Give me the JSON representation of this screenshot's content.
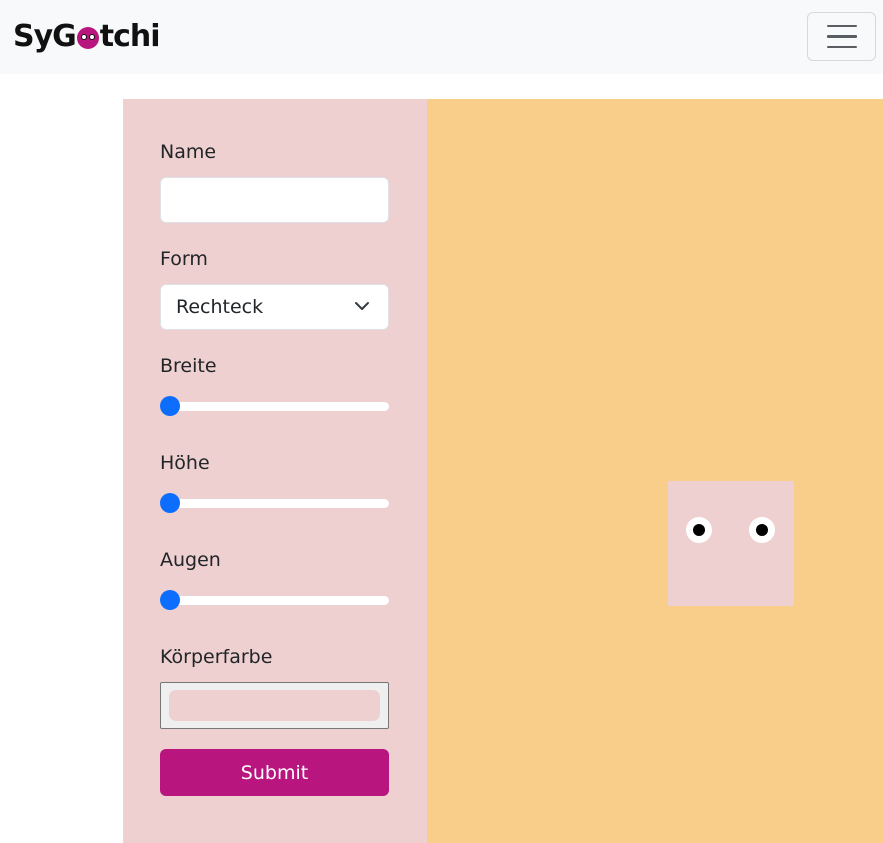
{
  "navbar": {
    "brand_prefix": "SyG",
    "brand_suffix": "tchi",
    "toggler_icon": "hamburger-icon"
  },
  "form": {
    "name_label": "Name",
    "name_value": "",
    "shape_label": "Form",
    "shape_selected": "Rechteck",
    "width_label": "Breite",
    "width_value": 0,
    "height_label": "Höhe",
    "height_value": 0,
    "eyes_label": "Augen",
    "eyes_value": 0,
    "color_label": "Körperfarbe",
    "color_value": "#efd0d0",
    "submit_label": "Submit"
  },
  "colors": {
    "form_background": "#efd0d0",
    "stage_background": "#f9ce8a",
    "pet_body": "#efd0d0",
    "submit_button": "#b8157f",
    "slider_thumb": "#0d6efd"
  },
  "pet": {
    "shape": "Rechteck",
    "eye_count": 2
  }
}
